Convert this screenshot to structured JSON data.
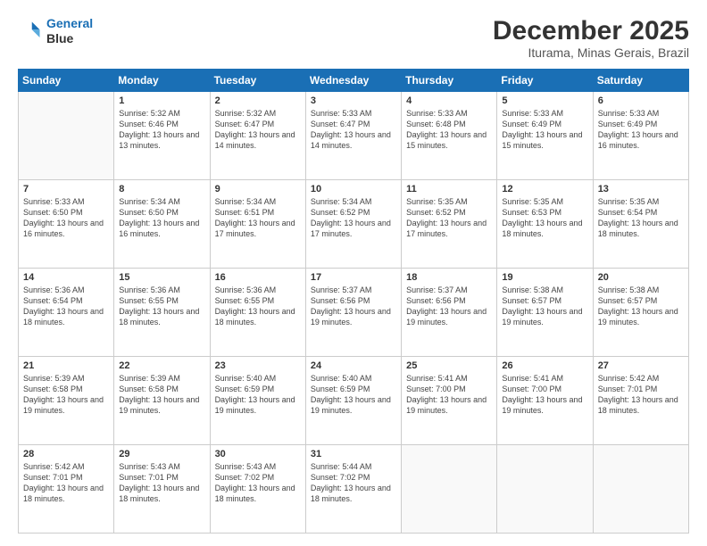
{
  "logo": {
    "line1": "General",
    "line2": "Blue"
  },
  "title": "December 2025",
  "location": "Iturama, Minas Gerais, Brazil",
  "weekdays": [
    "Sunday",
    "Monday",
    "Tuesday",
    "Wednesday",
    "Thursday",
    "Friday",
    "Saturday"
  ],
  "weeks": [
    [
      {
        "day": "",
        "sunrise": "",
        "sunset": "",
        "daylight": ""
      },
      {
        "day": "1",
        "sunrise": "Sunrise: 5:32 AM",
        "sunset": "Sunset: 6:46 PM",
        "daylight": "Daylight: 13 hours and 13 minutes."
      },
      {
        "day": "2",
        "sunrise": "Sunrise: 5:32 AM",
        "sunset": "Sunset: 6:47 PM",
        "daylight": "Daylight: 13 hours and 14 minutes."
      },
      {
        "day": "3",
        "sunrise": "Sunrise: 5:33 AM",
        "sunset": "Sunset: 6:47 PM",
        "daylight": "Daylight: 13 hours and 14 minutes."
      },
      {
        "day": "4",
        "sunrise": "Sunrise: 5:33 AM",
        "sunset": "Sunset: 6:48 PM",
        "daylight": "Daylight: 13 hours and 15 minutes."
      },
      {
        "day": "5",
        "sunrise": "Sunrise: 5:33 AM",
        "sunset": "Sunset: 6:49 PM",
        "daylight": "Daylight: 13 hours and 15 minutes."
      },
      {
        "day": "6",
        "sunrise": "Sunrise: 5:33 AM",
        "sunset": "Sunset: 6:49 PM",
        "daylight": "Daylight: 13 hours and 16 minutes."
      }
    ],
    [
      {
        "day": "7",
        "sunrise": "Sunrise: 5:33 AM",
        "sunset": "Sunset: 6:50 PM",
        "daylight": "Daylight: 13 hours and 16 minutes."
      },
      {
        "day": "8",
        "sunrise": "Sunrise: 5:34 AM",
        "sunset": "Sunset: 6:50 PM",
        "daylight": "Daylight: 13 hours and 16 minutes."
      },
      {
        "day": "9",
        "sunrise": "Sunrise: 5:34 AM",
        "sunset": "Sunset: 6:51 PM",
        "daylight": "Daylight: 13 hours and 17 minutes."
      },
      {
        "day": "10",
        "sunrise": "Sunrise: 5:34 AM",
        "sunset": "Sunset: 6:52 PM",
        "daylight": "Daylight: 13 hours and 17 minutes."
      },
      {
        "day": "11",
        "sunrise": "Sunrise: 5:35 AM",
        "sunset": "Sunset: 6:52 PM",
        "daylight": "Daylight: 13 hours and 17 minutes."
      },
      {
        "day": "12",
        "sunrise": "Sunrise: 5:35 AM",
        "sunset": "Sunset: 6:53 PM",
        "daylight": "Daylight: 13 hours and 18 minutes."
      },
      {
        "day": "13",
        "sunrise": "Sunrise: 5:35 AM",
        "sunset": "Sunset: 6:54 PM",
        "daylight": "Daylight: 13 hours and 18 minutes."
      }
    ],
    [
      {
        "day": "14",
        "sunrise": "Sunrise: 5:36 AM",
        "sunset": "Sunset: 6:54 PM",
        "daylight": "Daylight: 13 hours and 18 minutes."
      },
      {
        "day": "15",
        "sunrise": "Sunrise: 5:36 AM",
        "sunset": "Sunset: 6:55 PM",
        "daylight": "Daylight: 13 hours and 18 minutes."
      },
      {
        "day": "16",
        "sunrise": "Sunrise: 5:36 AM",
        "sunset": "Sunset: 6:55 PM",
        "daylight": "Daylight: 13 hours and 18 minutes."
      },
      {
        "day": "17",
        "sunrise": "Sunrise: 5:37 AM",
        "sunset": "Sunset: 6:56 PM",
        "daylight": "Daylight: 13 hours and 19 minutes."
      },
      {
        "day": "18",
        "sunrise": "Sunrise: 5:37 AM",
        "sunset": "Sunset: 6:56 PM",
        "daylight": "Daylight: 13 hours and 19 minutes."
      },
      {
        "day": "19",
        "sunrise": "Sunrise: 5:38 AM",
        "sunset": "Sunset: 6:57 PM",
        "daylight": "Daylight: 13 hours and 19 minutes."
      },
      {
        "day": "20",
        "sunrise": "Sunrise: 5:38 AM",
        "sunset": "Sunset: 6:57 PM",
        "daylight": "Daylight: 13 hours and 19 minutes."
      }
    ],
    [
      {
        "day": "21",
        "sunrise": "Sunrise: 5:39 AM",
        "sunset": "Sunset: 6:58 PM",
        "daylight": "Daylight: 13 hours and 19 minutes."
      },
      {
        "day": "22",
        "sunrise": "Sunrise: 5:39 AM",
        "sunset": "Sunset: 6:58 PM",
        "daylight": "Daylight: 13 hours and 19 minutes."
      },
      {
        "day": "23",
        "sunrise": "Sunrise: 5:40 AM",
        "sunset": "Sunset: 6:59 PM",
        "daylight": "Daylight: 13 hours and 19 minutes."
      },
      {
        "day": "24",
        "sunrise": "Sunrise: 5:40 AM",
        "sunset": "Sunset: 6:59 PM",
        "daylight": "Daylight: 13 hours and 19 minutes."
      },
      {
        "day": "25",
        "sunrise": "Sunrise: 5:41 AM",
        "sunset": "Sunset: 7:00 PM",
        "daylight": "Daylight: 13 hours and 19 minutes."
      },
      {
        "day": "26",
        "sunrise": "Sunrise: 5:41 AM",
        "sunset": "Sunset: 7:00 PM",
        "daylight": "Daylight: 13 hours and 19 minutes."
      },
      {
        "day": "27",
        "sunrise": "Sunrise: 5:42 AM",
        "sunset": "Sunset: 7:01 PM",
        "daylight": "Daylight: 13 hours and 18 minutes."
      }
    ],
    [
      {
        "day": "28",
        "sunrise": "Sunrise: 5:42 AM",
        "sunset": "Sunset: 7:01 PM",
        "daylight": "Daylight: 13 hours and 18 minutes."
      },
      {
        "day": "29",
        "sunrise": "Sunrise: 5:43 AM",
        "sunset": "Sunset: 7:01 PM",
        "daylight": "Daylight: 13 hours and 18 minutes."
      },
      {
        "day": "30",
        "sunrise": "Sunrise: 5:43 AM",
        "sunset": "Sunset: 7:02 PM",
        "daylight": "Daylight: 13 hours and 18 minutes."
      },
      {
        "day": "31",
        "sunrise": "Sunrise: 5:44 AM",
        "sunset": "Sunset: 7:02 PM",
        "daylight": "Daylight: 13 hours and 18 minutes."
      },
      {
        "day": "",
        "sunrise": "",
        "sunset": "",
        "daylight": ""
      },
      {
        "day": "",
        "sunrise": "",
        "sunset": "",
        "daylight": ""
      },
      {
        "day": "",
        "sunrise": "",
        "sunset": "",
        "daylight": ""
      }
    ]
  ]
}
